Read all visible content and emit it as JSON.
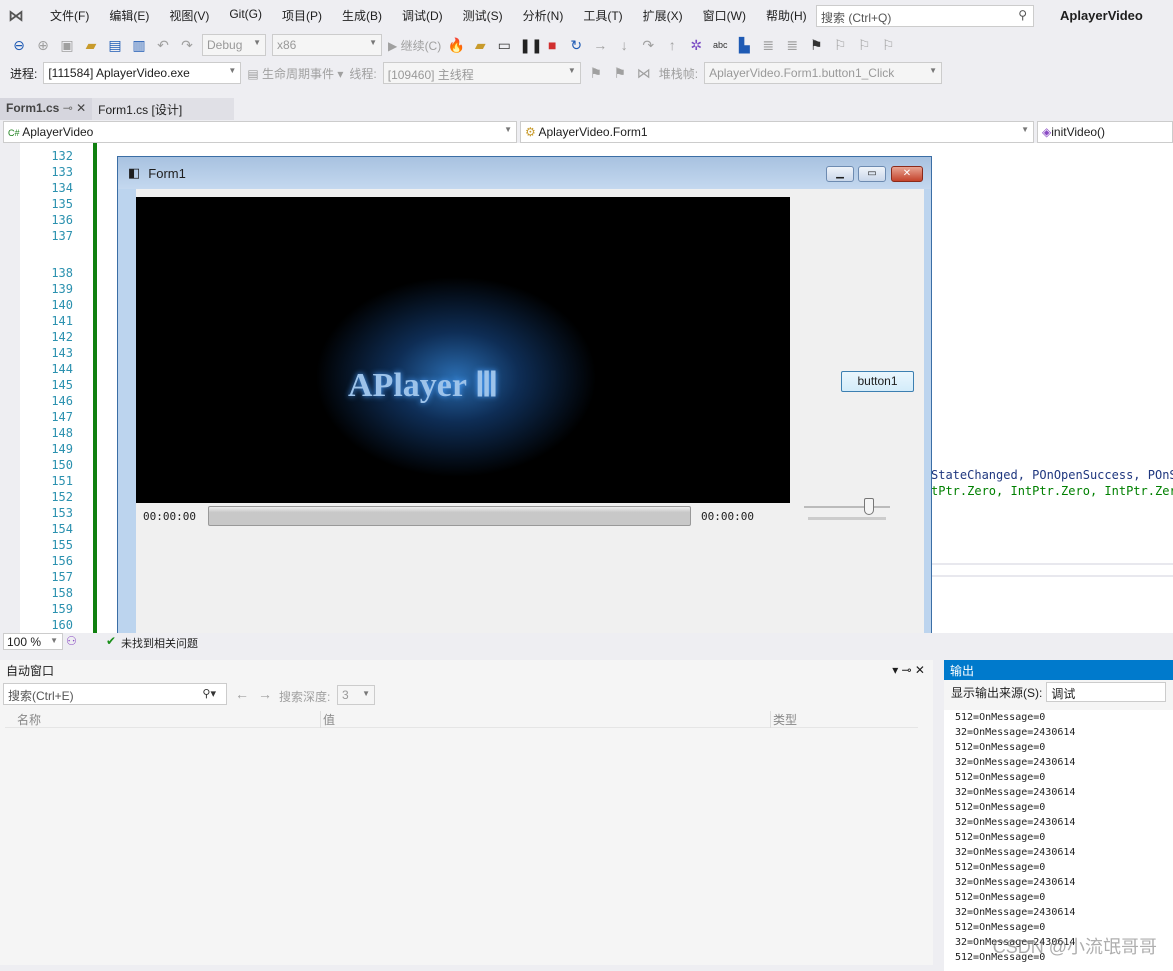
{
  "menu": [
    "文件(F)",
    "编辑(E)",
    "视图(V)",
    "Git(G)",
    "项目(P)",
    "生成(B)",
    "调试(D)",
    "测试(S)",
    "分析(N)",
    "工具(T)",
    "扩展(X)",
    "窗口(W)",
    "帮助(H)"
  ],
  "search": {
    "placeholder": "搜索 (Ctrl+Q)"
  },
  "app_title": "AplayerVideo",
  "toolbar": {
    "config": "Debug",
    "platform": "x86",
    "continue": "继续(C)"
  },
  "toolbar2": {
    "process_label": "进程:",
    "process": "[111584] AplayerVideo.exe",
    "lifecycle": "生命周期事件",
    "thread_label": "线程:",
    "thread": "[109460] 主线程",
    "stack_label": "堆栈帧:",
    "stack": "AplayerVideo.Form1.button1_Click"
  },
  "tabs": [
    {
      "label": "Form1.cs"
    },
    {
      "label": "Form1.cs [设计]"
    }
  ],
  "nav": {
    "project": "AplayerVideo",
    "class": "AplayerVideo.Form1",
    "member": "initVideo()"
  },
  "line_numbers": [
    "132",
    "133",
    "134",
    "135",
    "136",
    "137",
    "138",
    "139",
    "140",
    "141",
    "142",
    "143",
    "144",
    "145",
    "146",
    "147",
    "148",
    "149",
    "150",
    "151",
    "152",
    "153",
    "154",
    "155",
    "156",
    "157",
    "158",
    "159",
    "160"
  ],
  "code": {
    "line151": "StateChanged, POnOpenSuccess, POnSe",
    "line152": "tPtr.Zero, IntPtr.Zero, IntPtr.Zero"
  },
  "form": {
    "title": "Form1",
    "time_start": "00:00:00",
    "time_end": "00:00:00",
    "button": "button1",
    "video_logo": "APlayer Ⅲ",
    "volume": 0.85,
    "progress": 0
  },
  "status": {
    "zoom": "100 %",
    "issues": "未找到相关问题"
  },
  "autos": {
    "title": "自动窗口",
    "search_placeholder": "搜索(Ctrl+E)",
    "depth_label": "搜索深度:",
    "depth": "3",
    "columns": [
      "名称",
      "值",
      "类型"
    ]
  },
  "output": {
    "title": "输出",
    "source_label": "显示输出来源(S):",
    "source": "调试",
    "lines": [
      "512=OnMessage=0",
      "32=OnMessage=2430614",
      "512=OnMessage=0",
      "32=OnMessage=2430614",
      "512=OnMessage=0",
      "32=OnMessage=2430614",
      "512=OnMessage=0",
      "32=OnMessage=2430614",
      "512=OnMessage=0",
      "32=OnMessage=2430614",
      "512=OnMessage=0",
      "32=OnMessage=2430614",
      "512=OnMessage=0",
      "32=OnMessage=2430614",
      "512=OnMessage=0",
      "32=OnMessage=2430614",
      "512=OnMessage=0"
    ]
  },
  "watermark": "CSDN @小流氓哥哥"
}
